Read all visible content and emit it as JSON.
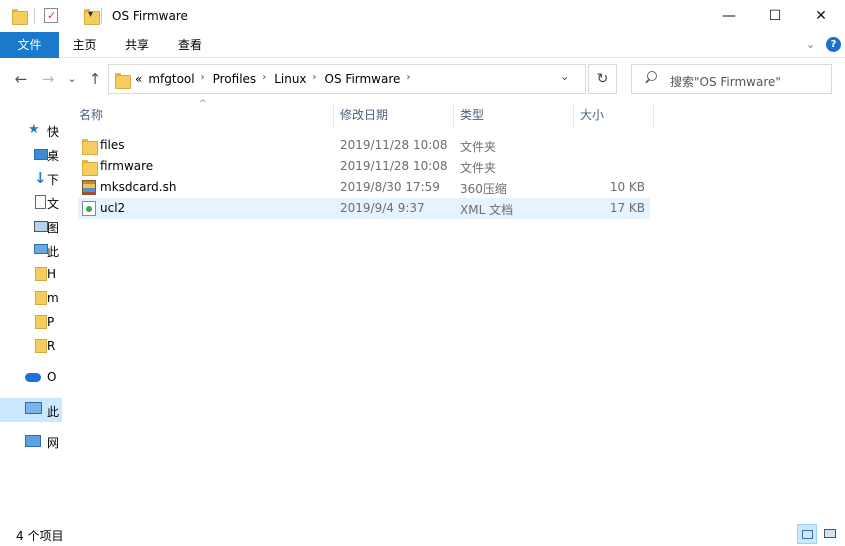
{
  "window": {
    "title": "OS Firmware",
    "minimize_glyph": "—",
    "maximize_glyph": "☐",
    "close_glyph": "✕"
  },
  "quick_access": {
    "dropdown_glyph": "▾"
  },
  "ribbon": {
    "tabs": [
      {
        "label": "文件"
      },
      {
        "label": "主页"
      },
      {
        "label": "共享"
      },
      {
        "label": "查看"
      }
    ],
    "expand_glyph": "⌄",
    "help_glyph": "?"
  },
  "navigation": {
    "back_glyph": "←",
    "forward_glyph": "→",
    "recent_glyph": "⌄",
    "up_glyph": "↑"
  },
  "address": {
    "overflow": "«",
    "crumbs": [
      "mfgtool",
      "Profiles",
      "Linux",
      "OS Firmware"
    ],
    "sep_glyph": "›",
    "dropdown_glyph": "⌄",
    "refresh_glyph": "↻"
  },
  "search": {
    "placeholder": "搜索\"OS Firmware\""
  },
  "nav_pane": {
    "items": [
      {
        "label": "快",
        "icon": "star-icon"
      },
      {
        "label": "桌",
        "icon": "desktop-icon"
      },
      {
        "label": "下",
        "icon": "download-icon"
      },
      {
        "label": "文",
        "icon": "document-icon"
      },
      {
        "label": "图",
        "icon": "picture-icon"
      },
      {
        "label": "此",
        "icon": "computer-icon"
      },
      {
        "label": "H",
        "icon": "folder-icon"
      },
      {
        "label": "m",
        "icon": "folder-icon"
      },
      {
        "label": "P",
        "icon": "folder-icon"
      },
      {
        "label": "R",
        "icon": "folder-icon"
      },
      {
        "label": "O",
        "icon": "onedrive-icon"
      },
      {
        "label": "此",
        "icon": "this-pc-icon"
      },
      {
        "label": "网",
        "icon": "network-icon"
      }
    ]
  },
  "columns": {
    "name": "名称",
    "date": "修改日期",
    "type": "类型",
    "size": "大小",
    "sort_glyph": "^"
  },
  "files": [
    {
      "name": "files",
      "date": "2019/11/28 10:08",
      "type": "文件夹",
      "size": "",
      "icon": "folder-icon"
    },
    {
      "name": "firmware",
      "date": "2019/11/28 10:08",
      "type": "文件夹",
      "size": "",
      "icon": "folder-icon"
    },
    {
      "name": "mksdcard.sh",
      "date": "2019/8/30 17:59",
      "type": "360压缩",
      "size": "10 KB",
      "icon": "archive-icon"
    },
    {
      "name": "ucl2",
      "date": "2019/9/4 9:37",
      "type": "XML 文档",
      "size": "17 KB",
      "icon": "xml-file-icon"
    }
  ],
  "status": {
    "item_count": "4 个项目"
  }
}
